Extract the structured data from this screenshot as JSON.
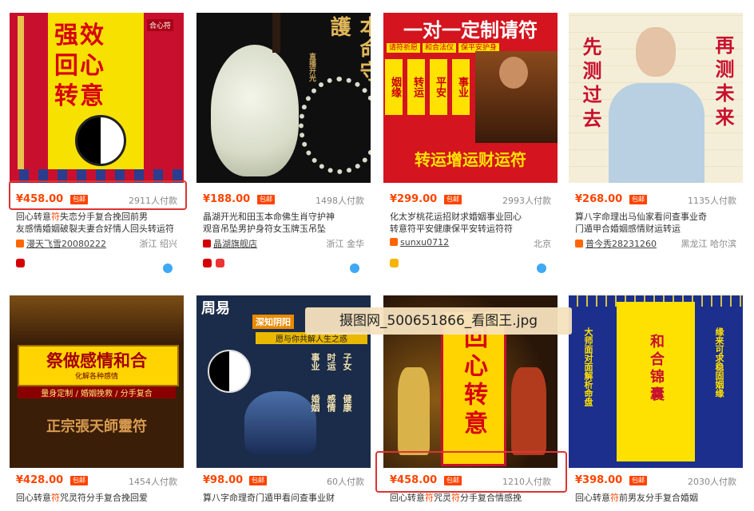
{
  "watermark": "摄图网_500651866_看图王.jpg",
  "products": [
    {
      "price": "¥458.00",
      "badge": "包邮",
      "paid": "2911人付款",
      "title_a": "回心转意",
      "title_hl": "符",
      "title_b": "失恋分手复合挽回前男",
      "title_line2": "友感情婚姻破裂夫妻合好情人回头转运符",
      "shop": "漫天飞雪20080222",
      "location": "浙江 绍兴",
      "img_main": "强效 回心 转意",
      "img_tag": "合心符"
    },
    {
      "price": "¥188.00",
      "badge": "包邮",
      "paid": "1498人付款",
      "title_a": "晶湖开光和田玉本命佛生肖守护神",
      "title_hl": "",
      "title_b": "",
      "title_line2": "观音吊坠男护身符女玉牌玉吊坠",
      "shop": "晶湖旗舰店",
      "location": "浙江 金华",
      "img_main": "本命守護",
      "img_tag": "直播开光"
    },
    {
      "price": "¥299.00",
      "badge": "包邮",
      "paid": "2993人付款",
      "title_a": "化太岁桃花运招财求婚姻事业回心",
      "title_hl": "",
      "title_b": "",
      "title_line2": "转意符平安健康保平安转运符符",
      "shop": "sunxu0712",
      "location": "北京",
      "img_main": "一对一定制请符",
      "img_sub": "转运增运财运符",
      "img_chips": [
        "请符祈愿",
        "和合法仪",
        "保平安护身"
      ],
      "img_cols": [
        "姻缘",
        "转运",
        "平安",
        "事业"
      ]
    },
    {
      "price": "¥268.00",
      "badge": "包邮",
      "paid": "1135人付款",
      "title_a": "算八字命理出马仙家看问查事业奇",
      "title_hl": "",
      "title_b": "",
      "title_line2": "门遁甲合婚姻感情财运转运",
      "shop": "普今秀28231260",
      "location": "黑龙江 哈尔滨",
      "img_left": "先测过去",
      "img_right": "再测未来"
    },
    {
      "price": "¥428.00",
      "badge": "包邮",
      "paid": "1454人付款",
      "title_a": "回心转意",
      "title_hl": "符",
      "title_b": "咒灵符分手复合挽回爱",
      "title_line2": "",
      "img_main": "祭做感情和合",
      "img_sub": "化解各种感情",
      "img_row": "量身定制 / 婚姻挽救 / 分手复合",
      "img_bottom": "正宗張天師靈符"
    },
    {
      "price": "¥98.00",
      "badge": "包邮",
      "paid": "60人付款",
      "title_a": "算八字命理奇门遁甲看问查事业财",
      "title_hl": "",
      "title_b": "",
      "title_line2": "",
      "img_brand": "周易",
      "img_tag": "深知阴阳",
      "img_sub": "愿与你共解人生之惑",
      "img_cols": [
        "事业",
        "时运",
        "子女",
        "婚姻",
        "感情",
        "健康"
      ]
    },
    {
      "price": "¥458.00",
      "badge": "包邮",
      "paid": "1210人付款",
      "title_a": "回心转意",
      "title_hl": "符",
      "title_b": "咒灵",
      "title_hl2": "符",
      "title_c": "分手复合情感挽",
      "title_line2": "",
      "img_main": "回心转意"
    },
    {
      "price": "¥398.00",
      "badge": "包邮",
      "paid": "2030人付款",
      "title_a": "回心转意",
      "title_hl": "符",
      "title_b": "前男友分手复合婚姻",
      "title_line2": "",
      "img_main": "和合锦囊",
      "img_left": "大师面对面解析命盘",
      "img_right": "缘来可求稳固姻缘"
    }
  ]
}
